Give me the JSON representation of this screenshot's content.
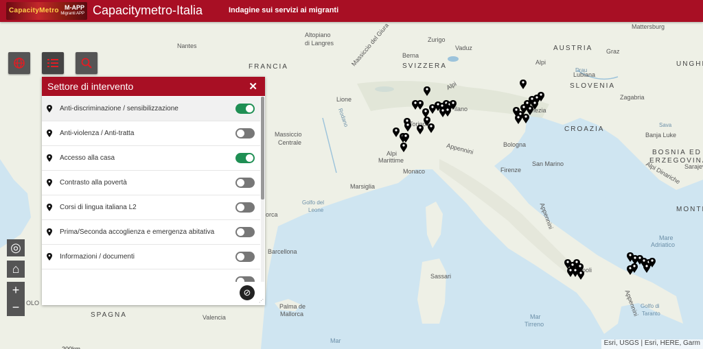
{
  "header": {
    "logo_text": "CapacityMetro",
    "logo_mapp": "M-APP",
    "logo_sub": "Migranti APP",
    "title": "Capacitymetro-Italia",
    "subtitle": "Indagine sui servizi ai migranti"
  },
  "toolbar": {
    "buttons": [
      "globe-icon",
      "list-icon",
      "search-icon"
    ],
    "accent": "#e11d24"
  },
  "panel": {
    "title": "Settore di intervento",
    "close": "✕",
    "items": [
      {
        "label": "Anti-discriminazione / sensibilizzazione",
        "on": true
      },
      {
        "label": "Anti-violenza / Anti-tratta",
        "on": false
      },
      {
        "label": "Accesso alla casa",
        "on": true
      },
      {
        "label": "Contrasto alla povertà",
        "on": false
      },
      {
        "label": "Corsi di lingua italiana L2",
        "on": false
      },
      {
        "label": "Prima/Seconda accoglienza e emergenza abitativa",
        "on": false
      },
      {
        "label": "Informazioni / documenti",
        "on": false
      }
    ],
    "clear_icon": "⊘"
  },
  "map": {
    "labels": {
      "mattersburg": "Mattersburg",
      "altopiano": "Altopiano",
      "di_langres": "di Langres",
      "nantes": "Nantes",
      "zurigo": "Zurigo",
      "vaduz": "Vaduz",
      "austria": "AUSTRIA",
      "graz": "Graz",
      "ungh": "UNGHE",
      "berna": "Berna",
      "svizzera": "SVIZZERA",
      "alpi_top": "Alpi",
      "francia": "FRANCIA",
      "massiccio_giura": "Massiccio del Giura",
      "drau": "Drau",
      "slovenia": "SLOVENIA",
      "alpi_mid": "Alpi",
      "lubiana": "Lubiana",
      "zagabria": "Zagabria",
      "lione": "Lione",
      "ilano": "ilano",
      "enezia": "enezia",
      "croazia": "CROAZIA",
      "rodano": "Rodano",
      "torino": "Torino",
      "massiccio": "Massiccio",
      "centrale": "Centrale",
      "sava": "Sava",
      "banja": "Banja Luke",
      "alpi_marittime": "Alpi",
      "marittime": "Marittime",
      "bologna": "Bologna",
      "appennini": "Appennini",
      "bosnia": "BOSNIA ED",
      "erzegovina": "ERZEGOVINA",
      "firenze": "Firenze",
      "san_marino": "San Marino",
      "monaco": "Monaco",
      "alpi_dinariche": "Alpi Dinariche",
      "sarajevo": "Sarajev",
      "marsiglia": "Marsiglia",
      "golfo_leone": "Golfo del",
      "leone": "Leone",
      "monte": "MONTE",
      "appennini2": "Appennini",
      "mare": "Mare",
      "adriatico": "Adriatico",
      "barcellona": "Barcellona",
      "napoli": "poli",
      "sassari": "Sassari",
      "mar_tirreno": "Mar",
      "tirreno": "Tirreno",
      "golfo_taranto": "Golfo di",
      "taranto": "Taranto",
      "spagna": "SPAGNA",
      "palma": "Palma de",
      "mallorca": "Mallorca",
      "valencia": "Valencia",
      "mar_bottom": "Mar",
      "olo": "OLO",
      "orca": "orca",
      "appennini3": "Appennini"
    },
    "scale_label": "200km",
    "attribution": "Esri, USGS | Esri, HERE, Garm",
    "land_color": "#eef0e6",
    "sea_color": "#cfe5f1"
  },
  "controls": {
    "locate_icon": "◎",
    "home_icon": "⌂",
    "zoom_in": "+",
    "zoom_out": "−"
  }
}
